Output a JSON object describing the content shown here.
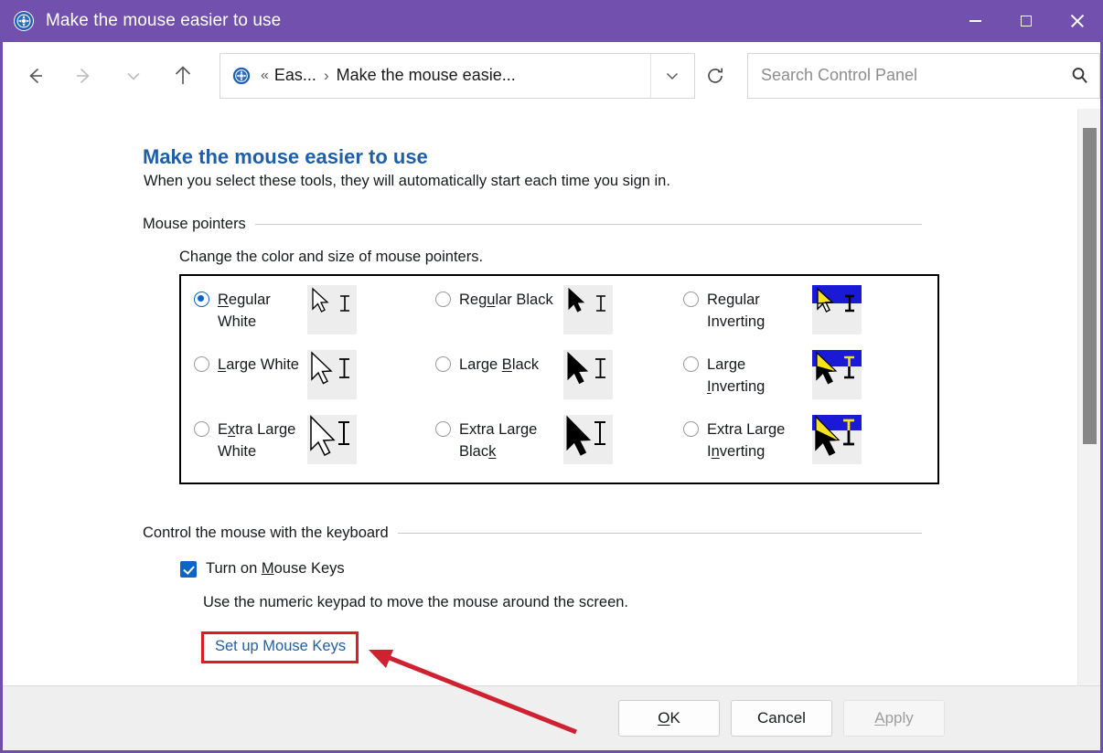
{
  "window": {
    "title": "Make the mouse easier to use",
    "icon": "ease-of-access-icon",
    "accent_color": "#7250ae",
    "minimize_label": "Minimize",
    "maximize_label": "Maximize",
    "close_label": "Close"
  },
  "nav": {
    "back": "back-arrow",
    "forward": "forward-arrow",
    "recent": "chevron-down",
    "up": "up-arrow",
    "refresh": "refresh-icon"
  },
  "address": {
    "icon": "ease-of-access-icon",
    "sep_double": "«",
    "crumb1": "Eas...",
    "sep": "›",
    "crumb2": "Make the mouse easie...",
    "chevron": "chevron-down-icon"
  },
  "search": {
    "placeholder": "Search Control Panel",
    "value": "",
    "icon": "search-icon"
  },
  "page": {
    "title": "Make the mouse easier to use",
    "subtitle": "When you select these tools, they will automatically start each time you sign in."
  },
  "pointers_section": {
    "header": "Mouse pointers",
    "description": "Change the color and size of mouse pointers.",
    "options": [
      {
        "id": "regular-white",
        "label_pre": "R",
        "label_key": "e",
        "label_post": "gular White",
        "checked": true,
        "style": "white"
      },
      {
        "id": "large-white",
        "label_pre": "",
        "label_key": "L",
        "label_post": "arge White",
        "checked": false,
        "style": "white"
      },
      {
        "id": "extra-large-white",
        "label_pre": "E",
        "label_key": "x",
        "label_post": "tra Large White",
        "checked": false,
        "style": "white"
      },
      {
        "id": "regular-black",
        "label_pre": "Reg",
        "label_key": "u",
        "label_post": "lar Black",
        "checked": false,
        "style": "black"
      },
      {
        "id": "large-black",
        "label_pre": "Large ",
        "label_key": "B",
        "label_post": "lack",
        "checked": false,
        "style": "black"
      },
      {
        "id": "extra-large-black",
        "label_pre": "Extra Large Blac",
        "label_key": "k",
        "label_post": "",
        "checked": false,
        "style": "black"
      },
      {
        "id": "regular-inverting",
        "label_pre": "Regular Inverting",
        "label_key": "",
        "label_post": "",
        "checked": false,
        "style": "inverting"
      },
      {
        "id": "large-inverting",
        "label_pre": "Large ",
        "label_key": "I",
        "label_post": "nverting",
        "checked": false,
        "style": "inverting"
      },
      {
        "id": "extra-large-inverting",
        "label_pre": "Extra Large I",
        "label_key": "n",
        "label_post": "verting",
        "checked": false,
        "style": "inverting"
      }
    ],
    "labels": [
      "Regular White",
      "Large White",
      "Extra Large White",
      "Regular Black",
      "Large Black",
      "Extra Large Black",
      "Regular Inverting",
      "Large Inverting",
      "Extra Large Inverting"
    ]
  },
  "keyboard_section": {
    "header": "Control the mouse with the keyboard",
    "checkbox_label": "Turn on Mouse Keys",
    "checkbox_checked": true,
    "description": "Use the numeric keypad to move the mouse around the screen.",
    "link": "Set up Mouse Keys",
    "highlight_color": "#e01b1b"
  },
  "footer": {
    "ok": "OK",
    "cancel": "Cancel",
    "apply": "Apply",
    "apply_disabled": true
  },
  "scrollbar": {
    "name": "vertical-scrollbar"
  }
}
